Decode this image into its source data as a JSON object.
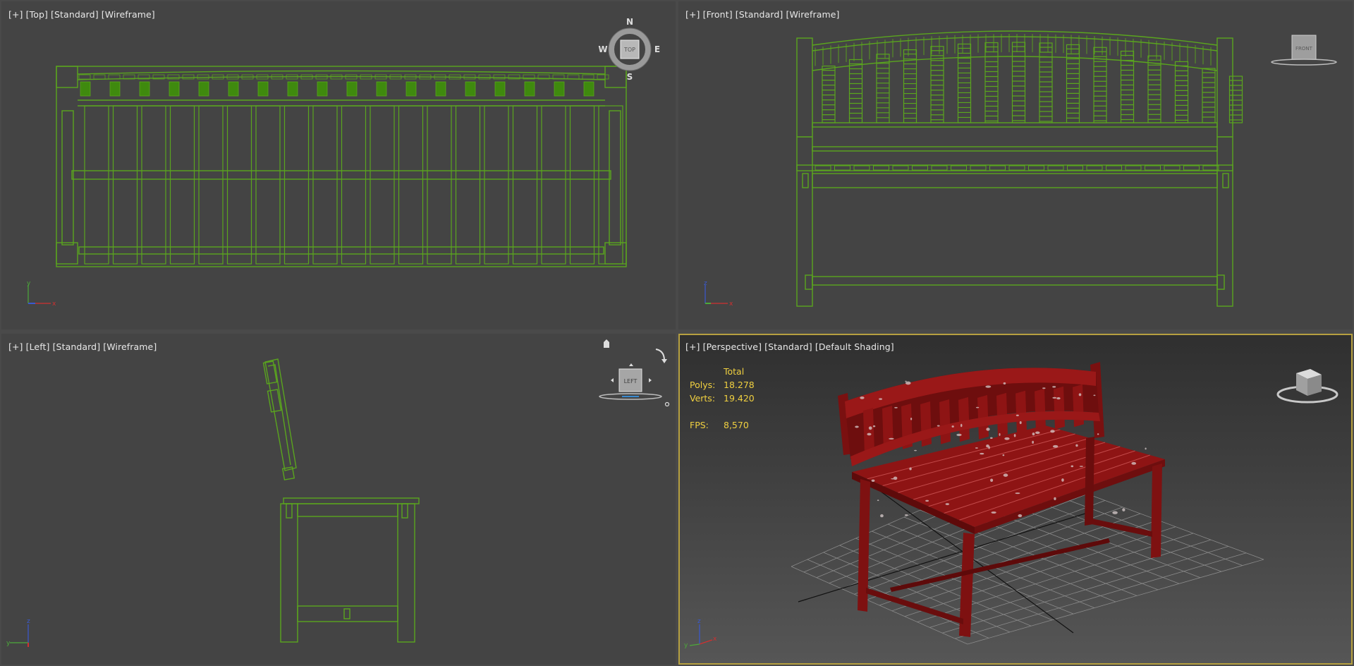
{
  "viewports": {
    "top": {
      "plus": "[+]",
      "view": "[Top]",
      "mode": "[Standard]",
      "shading": "[Wireframe]"
    },
    "front": {
      "plus": "[+]",
      "view": "[Front]",
      "mode": "[Standard]",
      "shading": "[Wireframe]"
    },
    "left": {
      "plus": "[+]",
      "view": "[Left]",
      "mode": "[Standard]",
      "shading": "[Wireframe]"
    },
    "perspective": {
      "plus": "[+]",
      "view": "[Perspective]",
      "mode": "[Standard]",
      "shading": "[Default Shading]"
    }
  },
  "viewcube": {
    "top_face": "TOP",
    "front_face": "FRONT",
    "left_face": "LEFT",
    "compass": {
      "n": "N",
      "s": "S",
      "e": "E",
      "w": "W"
    }
  },
  "axes": {
    "x": "x",
    "y": "y",
    "z": "z"
  },
  "stats": {
    "total_label": "Total",
    "polys_label": "Polys:",
    "polys_value": "18.278",
    "verts_label": "Verts:",
    "verts_value": "19.420",
    "fps_label": "FPS:",
    "fps_value": "8,570"
  },
  "colors": {
    "wire": "#5aa51e",
    "viewport_bg": "#444444",
    "active_border": "#b6a040",
    "stats_text": "#f0d040",
    "bench_red": "#8e1414"
  }
}
